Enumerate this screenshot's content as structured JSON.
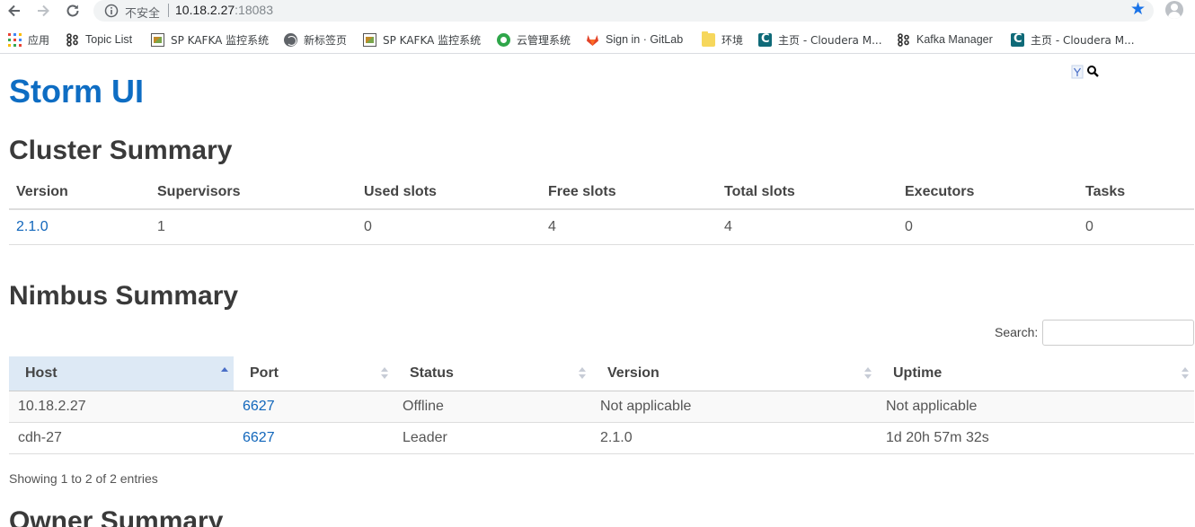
{
  "browser": {
    "insecure_label": "不安全",
    "url_host": "10.18.2.27",
    "url_port": ":18083",
    "bookmarks": [
      {
        "label": "应用",
        "icon": "apps-grid-icon"
      },
      {
        "label": "Topic List",
        "icon": "kafka-icon"
      },
      {
        "label": "SP KAFKA 监控系统",
        "icon": "image-icon"
      },
      {
        "label": "新标签页",
        "icon": "globe-icon"
      },
      {
        "label": "SP KAFKA 监控系统",
        "icon": "image-icon"
      },
      {
        "label": "云管理系统",
        "icon": "cloud-icon"
      },
      {
        "label": "Sign in · GitLab",
        "icon": "gitlab-icon"
      },
      {
        "label": "环境",
        "icon": "folder-icon"
      },
      {
        "label": "主页 - Cloudera M...",
        "icon": "cloudera-icon"
      },
      {
        "label": "Kafka Manager",
        "icon": "kafka-icon"
      },
      {
        "label": "主页 - Cloudera M...",
        "icon": "cloudera-icon"
      }
    ]
  },
  "page": {
    "title": "Storm UI"
  },
  "cluster_summary": {
    "heading": "Cluster Summary",
    "columns": [
      "Version",
      "Supervisors",
      "Used slots",
      "Free slots",
      "Total slots",
      "Executors",
      "Tasks"
    ],
    "row": [
      "2.1.0",
      "1",
      "0",
      "4",
      "4",
      "0",
      "0"
    ]
  },
  "nimbus_summary": {
    "heading": "Nimbus Summary",
    "search_label": "Search:",
    "search_value": "",
    "columns": [
      "Host",
      "Port",
      "Status",
      "Version",
      "Uptime"
    ],
    "sorted_column": "Host",
    "rows": [
      [
        "10.18.2.27",
        "6627",
        "Offline",
        "Not applicable",
        "Not applicable"
      ],
      [
        "cdh-27",
        "6627",
        "Leader",
        "2.1.0",
        "1d 20h 57m 32s"
      ]
    ],
    "info": "Showing 1 to 2 of 2 entries"
  },
  "owner_summary": {
    "heading": "Owner Summary"
  },
  "colors": {
    "title_blue": "#0e6dc3",
    "link_blue": "#1166bb",
    "sorted_header_bg": "#dde9f5"
  }
}
